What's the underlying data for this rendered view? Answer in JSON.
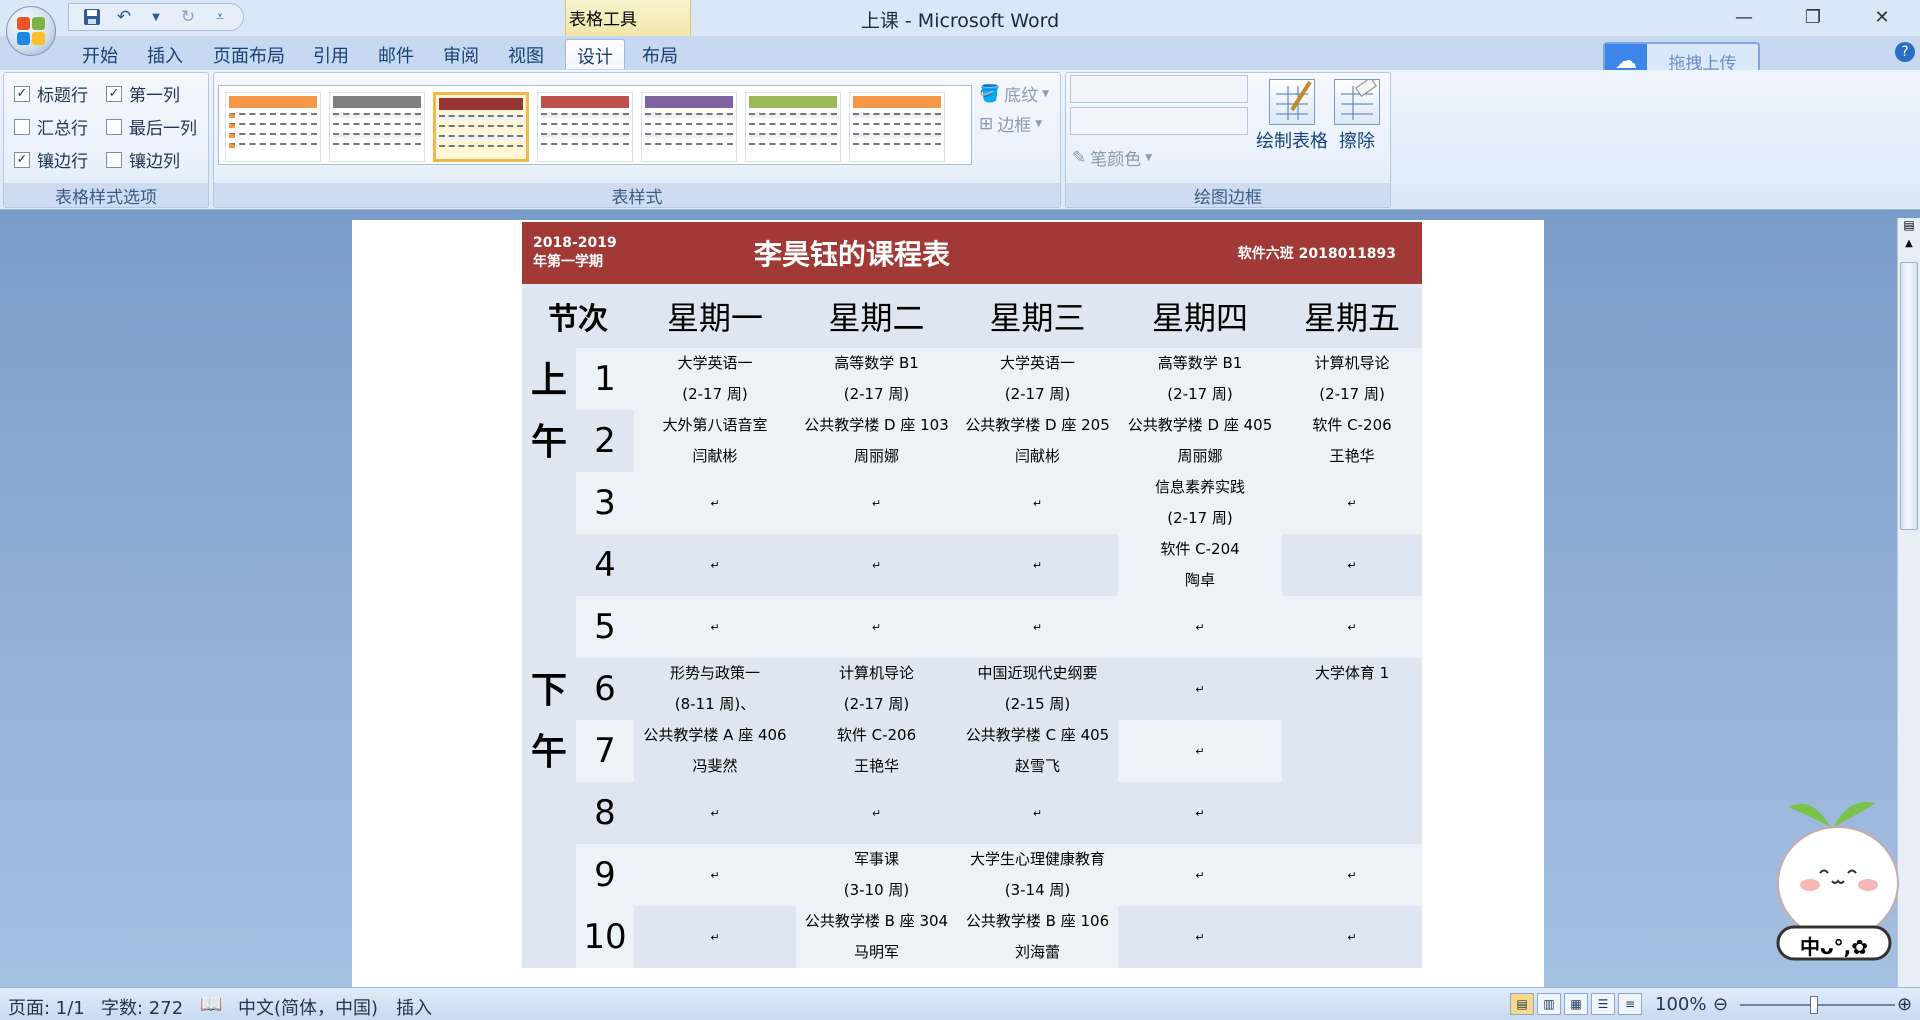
{
  "app": {
    "window_title": "上课 - Microsoft Word",
    "contextual_group": "表格工具"
  },
  "window_controls": {
    "minimize": "—",
    "restore": "❐",
    "close": "✕"
  },
  "qat": {
    "save_icon": "save-icon",
    "undo_icon": "undo-icon",
    "redo_icon": "redo-icon",
    "customize_icon": "customize-icon"
  },
  "tabs": [
    "开始",
    "插入",
    "页面布局",
    "引用",
    "邮件",
    "审阅",
    "视图",
    "设计",
    "布局"
  ],
  "active_tab": "设计",
  "upload": {
    "label": "拖拽上传",
    "icon": "cloud-icon"
  },
  "ribbon": {
    "options_group": {
      "label": "表格样式选项",
      "checks": [
        {
          "label": "标题行",
          "checked": true
        },
        {
          "label": "第一列",
          "checked": true
        },
        {
          "label": "汇总行",
          "checked": false
        },
        {
          "label": "最后一列",
          "checked": false
        },
        {
          "label": "镶边行",
          "checked": true
        },
        {
          "label": "镶边列",
          "checked": false
        }
      ]
    },
    "styles_group": {
      "label": "表样式",
      "shading": "底纹",
      "border": "边框",
      "thumb_colors": [
        "#f79646",
        "#7f7f7f",
        "#953735",
        "#c0504d",
        "#8064a2",
        "#9bbb59",
        "#f79646"
      ],
      "selected_index": 2
    },
    "draw_group": {
      "label": "绘图边框",
      "pen_color": "笔颜色",
      "draw_table": "绘制表格",
      "eraser": "擦除"
    }
  },
  "document": {
    "term": "2018-2019 年第一学期",
    "title": "李昊钰的课程表",
    "class_info": "软件六班  2018011893",
    "header_period": "节次",
    "days": [
      "星期一",
      "星期二",
      "星期三",
      "星期四",
      "星期五"
    ],
    "morning": "上\n午",
    "afternoon": "下\n午",
    "mark": "↵",
    "periods": [
      "1",
      "2",
      "3",
      "4",
      "5",
      "6",
      "7",
      "8",
      "9",
      "10"
    ],
    "courses": {
      "mon_am": [
        "大学英语一",
        "(2-17 周)",
        "大外第八语音室",
        "闫献彬"
      ],
      "tue_am": [
        "高等数学 B1",
        "(2-17 周)",
        "公共教学楼 D 座 103",
        "周丽娜"
      ],
      "wed_am": [
        "大学英语一",
        "(2-17 周)",
        "公共教学楼 D 座 205",
        "闫献彬"
      ],
      "thu_am": [
        "高等数学 B1",
        "(2-17 周)",
        "公共教学楼 D 座 405",
        "周丽娜"
      ],
      "fri_am": [
        "计算机导论",
        "(2-17 周)",
        "软件 C-206",
        "王艳华"
      ],
      "thu_34": [
        "信息素养实践",
        "(2-17 周)",
        "软件 C-204",
        "陶卓"
      ],
      "mon_pm": [
        "形势与政策一",
        "(8-11 周)、",
        "公共教学楼 A 座 406",
        "冯斐然"
      ],
      "tue_pm": [
        "计算机导论",
        "(2-17 周)",
        "软件 C-206",
        "王艳华"
      ],
      "wed_pm": [
        "中国近现代史纲要",
        "(2-15 周)",
        "公共教学楼 C 座 405",
        "赵雪飞"
      ],
      "fri_pm": [
        "大学体育 1"
      ],
      "tue_910": [
        "军事课",
        "(3-10 周)",
        "公共教学楼 B 座 304",
        "马明军"
      ],
      "wed_910": [
        "大学生心理健康教育",
        "(3-14 周)",
        "公共教学楼 B 座 106",
        "刘海蕾"
      ]
    }
  },
  "statusbar": {
    "page": "页面: 1/1",
    "words": "字数: 272",
    "language": "中文(简体，中国)",
    "mode": "插入",
    "zoom": "100%"
  },
  "sticker": {
    "text": "中ᴗ°,✿"
  }
}
